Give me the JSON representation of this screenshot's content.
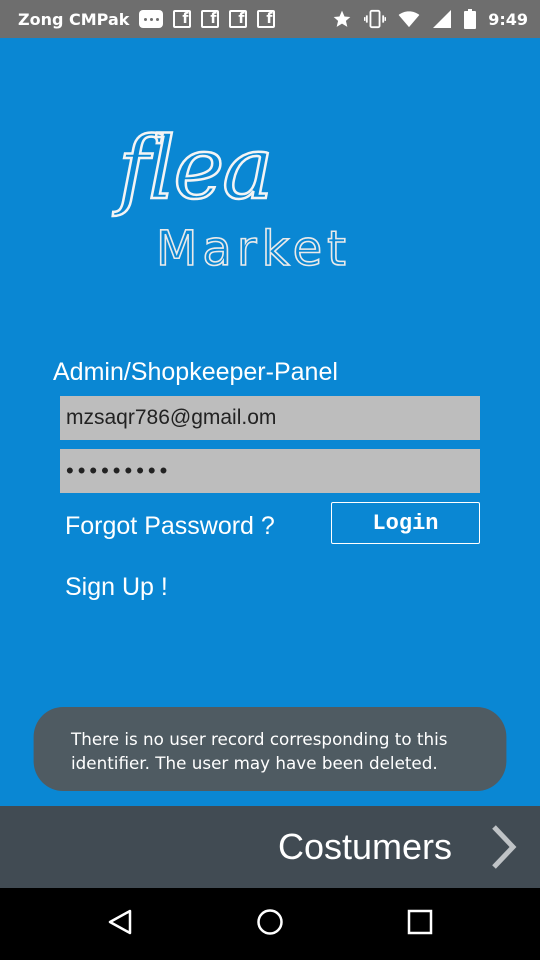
{
  "status_bar": {
    "carrier": "Zong CMPak",
    "time": "9:49",
    "icons": [
      "messages-icon",
      "facebook-icon",
      "facebook-icon",
      "facebook-icon",
      "facebook-icon",
      "star-icon",
      "vibrate-icon",
      "wifi-icon",
      "signal-icon",
      "battery-icon"
    ]
  },
  "logo": {
    "line1": "flea",
    "line2": "Market"
  },
  "login": {
    "panel_title": "Admin/Shopkeeper-Panel",
    "email_value": "mzsaqr786@gmail.om",
    "password_masked": "•••••••••",
    "forgot_label": "Forgot Password ?",
    "login_label": "Login",
    "signup_label": "Sign Up !"
  },
  "toast": {
    "message": "There is no user record corresponding to this identifier. The user may have been deleted."
  },
  "bottom_bar": {
    "label": "Costumers",
    "icon": "chevron-right-icon"
  },
  "nav_bar": {
    "icons": [
      "back-icon",
      "home-icon",
      "recents-icon"
    ]
  },
  "colors": {
    "background": "#0A87D3",
    "status_bar": "#6E6E6E",
    "input_bg": "#BDBDBD",
    "toast_bg": "#4F5B62",
    "bottom_bar": "#414B53",
    "nav_bar": "#000000"
  }
}
